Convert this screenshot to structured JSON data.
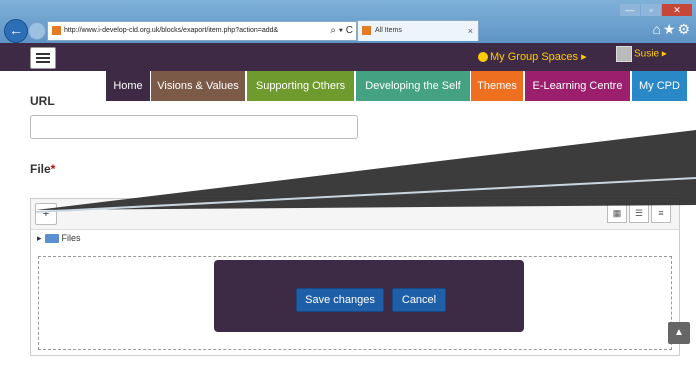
{
  "browser": {
    "address": "http://www.i-develop-cld.org.uk/blocks/exaport/item.php?action=add&",
    "tab_title": "All Items",
    "back_glyph": "←",
    "addr_icons": "⌕ ▾ C",
    "tab_close": "×",
    "window_controls": [
      "—",
      "▫",
      "✕"
    ],
    "right_icons": "⌂★⚙"
  },
  "header": {
    "groups": "My Group Spaces ▸",
    "user": "Susie ▸",
    "colors": {
      "bar": "#3e2a44",
      "accent": "#ffcc00"
    }
  },
  "nav": [
    {
      "label": "Home",
      "color": "#3e2a44"
    },
    {
      "label": "Visions & Values",
      "color": "#7b5a48"
    },
    {
      "label": "Supporting Others",
      "color": "#6e9a2e"
    },
    {
      "label": "Developing the Self",
      "color": "#44a283"
    },
    {
      "label": "Themes",
      "color": "#ee6f1f"
    },
    {
      "label": "E-Learning Centre",
      "color": "#9c1f6e"
    },
    {
      "label": "My CPD",
      "color": "#2b88c7"
    }
  ],
  "form": {
    "url_label": "URL",
    "url_value": "",
    "file_label": "File",
    "required_mark": "*",
    "files_path": "Files",
    "path_arrow": "▸",
    "add_glyph": "+",
    "view_glyphs": [
      "▦",
      "☰",
      "≡"
    ]
  },
  "dialog": {
    "save_label": "Save changes",
    "cancel_label": "Cancel",
    "colors": {
      "bg": "#3d2b45",
      "button": "#1f5fa8"
    }
  },
  "scroll_up_glyph": "▲"
}
